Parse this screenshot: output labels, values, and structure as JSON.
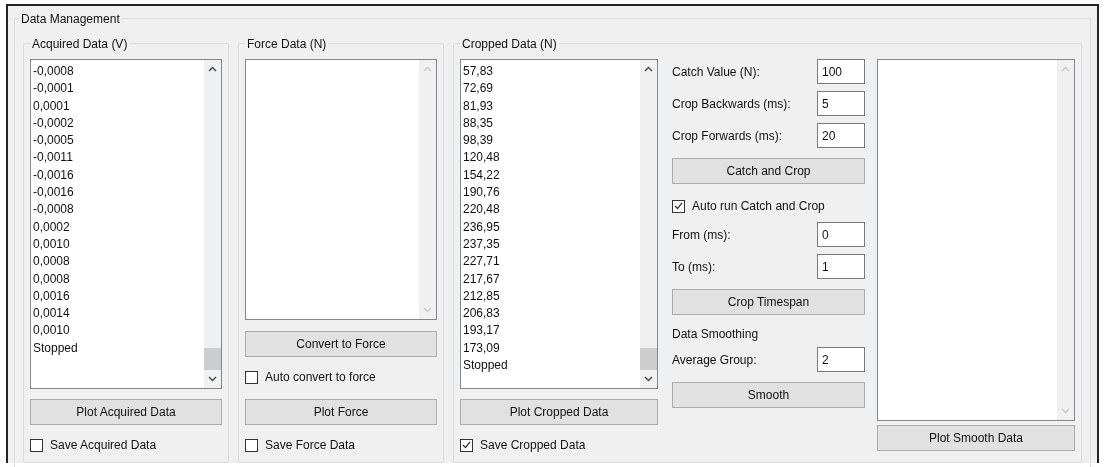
{
  "group_title": "Data Management",
  "acquired": {
    "title": "Acquired Data (V)",
    "items": [
      "-0,0008",
      "-0,0001",
      "0,0001",
      "-0,0002",
      "-0,0005",
      "-0,0011",
      "-0,0016",
      "-0,0016",
      "-0,0008",
      "0,0002",
      "0,0010",
      "0,0008",
      "0,0008",
      "0,0016",
      "0,0014",
      "0,0010",
      "Stopped"
    ],
    "plot_button": "Plot Acquired Data",
    "save_checkbox": {
      "label": "Save Acquired Data",
      "checked": false
    }
  },
  "force": {
    "title": "Force Data (N)",
    "convert_button": "Convert to Force",
    "auto_convert": {
      "label": "Auto convert to force",
      "checked": false
    },
    "plot_button": "Plot Force",
    "save_checkbox": {
      "label": "Save Force Data",
      "checked": false
    }
  },
  "cropped": {
    "title": "Cropped Data (N)",
    "items": [
      "57,83",
      "72,69",
      "81,93",
      "88,35",
      "98,39",
      "120,48",
      "154,22",
      "190,76",
      "220,48",
      "236,95",
      "237,35",
      "227,71",
      "217,67",
      "212,85",
      "206,83",
      "193,17",
      "173,09",
      "Stopped"
    ],
    "plot_button": "Plot Cropped Data",
    "save_checkbox": {
      "label": "Save Cropped Data",
      "checked": true
    }
  },
  "catch": {
    "fields": [
      {
        "label": "Catch Value (N):",
        "value": "100"
      },
      {
        "label": "Crop Backwards (ms):",
        "value": "5"
      },
      {
        "label": "Crop Forwards (ms):",
        "value": "20"
      }
    ],
    "button": "Catch and Crop",
    "auto_run": {
      "label": "Auto run Catch and Crop",
      "checked": true
    }
  },
  "timespan": {
    "fields": [
      {
        "label": "From (ms):",
        "value": "0"
      },
      {
        "label": "To (ms):",
        "value": "1"
      }
    ],
    "button": "Crop Timespan"
  },
  "smoothing": {
    "title": "Data Smoothing",
    "field": {
      "label": "Average Group:",
      "value": "2"
    },
    "button": "Smooth"
  },
  "smooth": {
    "plot_button": "Plot Smooth Data"
  }
}
